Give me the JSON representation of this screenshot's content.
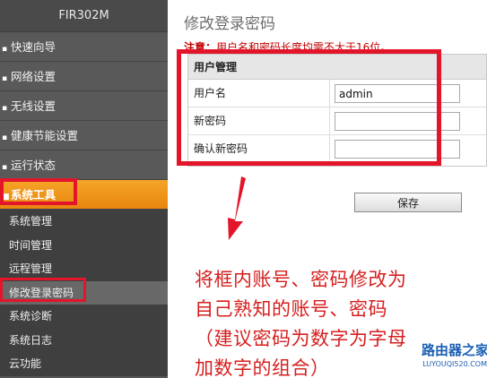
{
  "sidebar": {
    "brand": "FIR302M",
    "menu": [
      {
        "label": "快速向导",
        "bullet": "▪"
      },
      {
        "label": "网络设置",
        "bullet": "▪"
      },
      {
        "label": "无线设置",
        "bullet": "▪"
      },
      {
        "label": "健康节能设置",
        "bullet": "▪"
      },
      {
        "label": "运行状态",
        "bullet": "▪"
      },
      {
        "label": "系统工具",
        "bullet": "■"
      }
    ],
    "submenu": [
      "系统管理",
      "时间管理",
      "远程管理",
      "修改登录密码",
      "系统诊断",
      "系统日志",
      "云功能"
    ]
  },
  "main": {
    "title": "修改登录密码",
    "notice_label": "注意：",
    "notice_text": "用户名和密码长度均需不大于16位。",
    "panel_header": "用户管理",
    "fields": {
      "username_label": "用户名",
      "username_value": "admin",
      "new_password_label": "新密码",
      "confirm_password_label": "确认新密码"
    },
    "save_label": "保存"
  },
  "annotation": {
    "line1": "将框内账号、密码修改为",
    "line2": "自己熟知的账号、密码",
    "line3": "（建议密码为数字为字母",
    "line4": "加数字的组合）"
  },
  "watermark": {
    "name": "路由器之家",
    "url": "LUYOUQI520.COM"
  },
  "colors": {
    "highlight_red": "#e3152a",
    "menu_active_orange": "#f5a628",
    "sidebar_gray": "#565656",
    "annotation_red": "#d61f1f"
  }
}
